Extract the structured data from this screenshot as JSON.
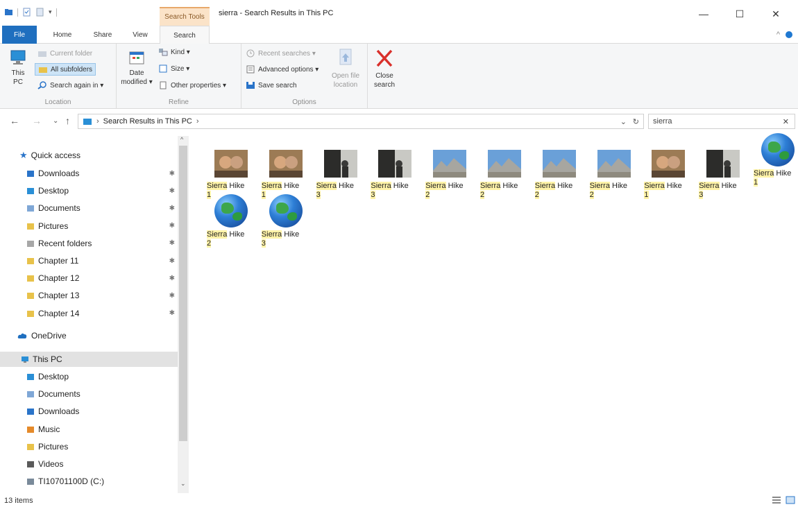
{
  "window": {
    "title": "sierra - Search Results in This PC",
    "context_tab": "Search Tools",
    "controls": {
      "minimize": "—",
      "maximize": "☐",
      "close": "✕"
    }
  },
  "tabs": {
    "file": "File",
    "home": "Home",
    "share": "Share",
    "view": "View",
    "search": "Search"
  },
  "ribbon": {
    "location": {
      "label": "Location",
      "this_pc": "This PC",
      "current_folder": "Current folder",
      "all_subfolders": "All subfolders",
      "search_again": "Search again in ▾"
    },
    "refine": {
      "label": "Refine",
      "date_modified": "Date modified ▾",
      "kind": "Kind ▾",
      "size": "Size ▾",
      "other_properties": "Other properties ▾"
    },
    "options": {
      "label": "Options",
      "recent_searches": "Recent searches ▾",
      "advanced_options": "Advanced options ▾",
      "save_search": "Save search",
      "open_file_location": "Open file location",
      "close_search": "Close search"
    }
  },
  "address": {
    "path": "Search Results in This PC",
    "search_value": "sierra"
  },
  "nav": {
    "quick_access": "Quick access",
    "quick_items": [
      {
        "label": "Downloads",
        "icon": "downloads-folder-icon",
        "color": "#2a74c9"
      },
      {
        "label": "Desktop",
        "icon": "desktop-folder-icon",
        "color": "#2a8fd6"
      },
      {
        "label": "Documents",
        "icon": "documents-folder-icon",
        "color": "#7fa7d6"
      },
      {
        "label": "Pictures",
        "icon": "pictures-folder-icon",
        "color": "#e8c24a"
      },
      {
        "label": "Recent folders",
        "icon": "recent-folders-icon",
        "color": "#a7a7a7"
      },
      {
        "label": "Chapter 11",
        "icon": "folder-icon",
        "color": "#e8c24a"
      },
      {
        "label": "Chapter 12",
        "icon": "folder-icon",
        "color": "#e8c24a"
      },
      {
        "label": "Chapter 13",
        "icon": "folder-icon",
        "color": "#e8c24a"
      },
      {
        "label": "Chapter 14",
        "icon": "folder-icon",
        "color": "#e8c24a"
      }
    ],
    "onedrive": "OneDrive",
    "this_pc": "This PC",
    "pc_items": [
      {
        "label": "Desktop",
        "icon": "desktop-folder-icon",
        "color": "#2a8fd6"
      },
      {
        "label": "Documents",
        "icon": "documents-folder-icon",
        "color": "#7fa7d6"
      },
      {
        "label": "Downloads",
        "icon": "downloads-folder-icon",
        "color": "#2a74c9"
      },
      {
        "label": "Music",
        "icon": "music-folder-icon",
        "color": "#e58a2a"
      },
      {
        "label": "Pictures",
        "icon": "pictures-folder-icon",
        "color": "#e8c24a"
      },
      {
        "label": "Videos",
        "icon": "videos-folder-icon",
        "color": "#5a5a5a"
      },
      {
        "label": "TI10701100D (C:)",
        "icon": "drive-icon",
        "color": "#7a8a9a"
      }
    ]
  },
  "results": [
    {
      "hl": "Sierra",
      "rest": " Hike",
      "num": "1",
      "kind": "couple"
    },
    {
      "hl": "Sierra",
      "rest": " Hike",
      "num": "1",
      "kind": "couple"
    },
    {
      "hl": "Sierra",
      "rest": " Hike",
      "num": "3",
      "kind": "person"
    },
    {
      "hl": "Sierra",
      "rest": " Hike",
      "num": "3",
      "kind": "person"
    },
    {
      "hl": "Sierra",
      "rest": " Hike",
      "num": "2",
      "kind": "mountain"
    },
    {
      "hl": "Sierra",
      "rest": " Hike",
      "num": "2",
      "kind": "mountain"
    },
    {
      "hl": "Sierra",
      "rest": " Hike",
      "num": "2",
      "kind": "mountain"
    },
    {
      "hl": "Sierra",
      "rest": " Hike",
      "num": "2",
      "kind": "mountain"
    },
    {
      "hl": "Sierra",
      "rest": " Hike",
      "num": "1",
      "kind": "couple"
    },
    {
      "hl": "Sierra",
      "rest": " Hike",
      "num": "3",
      "kind": "person"
    },
    {
      "hl": "Sierra",
      "rest": " Hike",
      "num": "1",
      "kind": "globe"
    },
    {
      "hl": "Sierra",
      "rest": " Hike",
      "num": "2",
      "kind": "globe"
    },
    {
      "hl": "Sierra",
      "rest": " Hike",
      "num": "3",
      "kind": "globe"
    }
  ],
  "status": {
    "count": "13 items"
  }
}
